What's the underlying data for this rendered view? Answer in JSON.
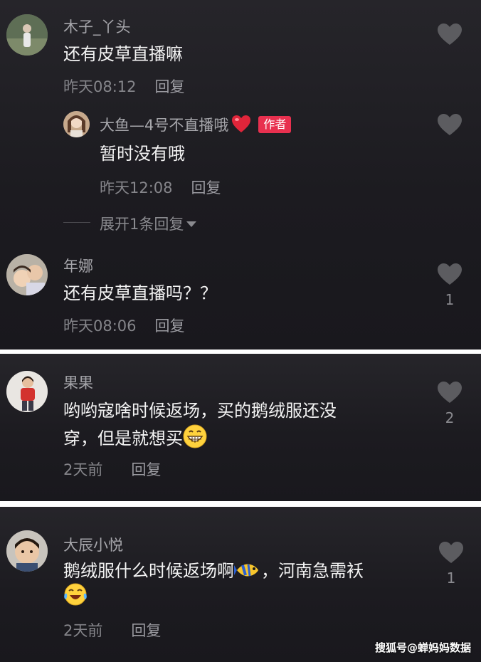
{
  "panel1": {
    "comment1": {
      "username": "木子_丫头",
      "text": "还有皮草直播嘛",
      "time": "昨天08:12",
      "reply_label": "回复"
    },
    "reply1": {
      "username": "大鱼—4号不直播哦",
      "badge": "作者",
      "text": "暂时没有哦",
      "time": "昨天12:08",
      "reply_label": "回复"
    },
    "expand_label": "展开1条回复",
    "comment2": {
      "username": "年娜",
      "text": "还有皮草直播吗？？",
      "time": "昨天08:06",
      "reply_label": "回复",
      "likes": "1"
    }
  },
  "panel2": {
    "comment": {
      "username": "果果",
      "line1": "哟哟寇啥时候返场，买的鹅绒服还没",
      "line2": "穿，但是就想买",
      "time": "2天前",
      "reply_label": "回复",
      "likes": "2"
    }
  },
  "panel3": {
    "comment": {
      "username": "大辰小悦",
      "line1_a": "鹅绒服什么时候返场啊",
      "line1_b": "，河南急需袄",
      "time": "2天前",
      "reply_label": "回复",
      "likes": "1"
    }
  },
  "watermark": "搜狐号@蝉妈妈数据",
  "colors": {
    "background": "#1c1b20",
    "badge": "#e8304f",
    "heart_icon": "#5c5c60",
    "heart_emoji": "#e0253a"
  },
  "icons": {
    "like": "heart-outline-icon",
    "author_heart": "red-heart-emoji",
    "grin": "grinning-face-emoji",
    "fish": "tropical-fish-emoji",
    "laugh": "tears-of-joy-emoji"
  }
}
